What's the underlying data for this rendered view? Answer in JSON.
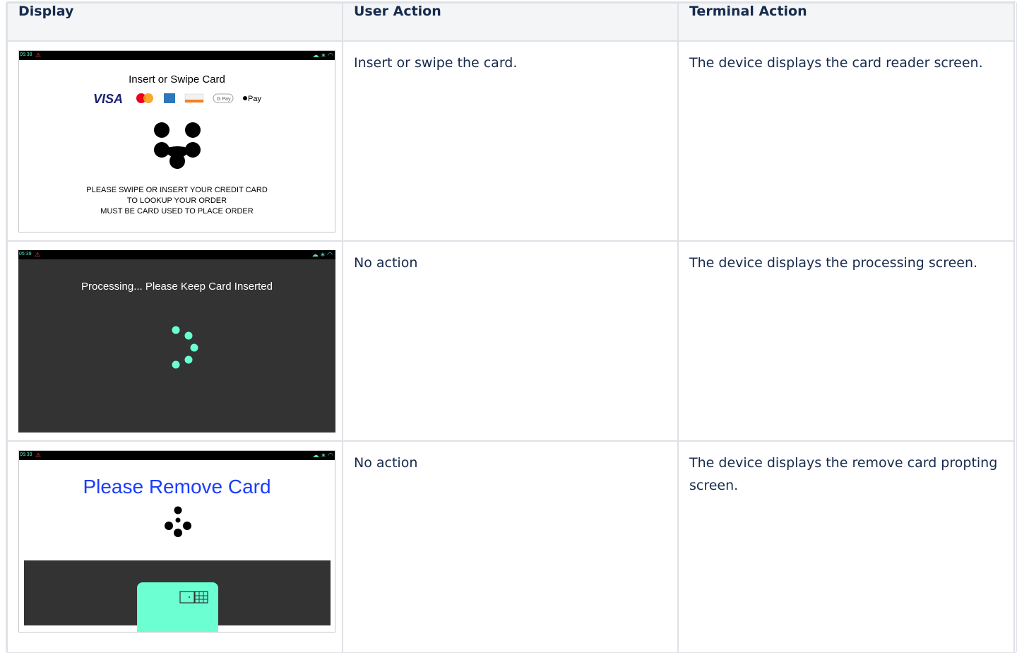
{
  "table": {
    "headers": [
      "Display",
      "User Action",
      "Terminal Action"
    ],
    "rows": [
      {
        "user_action": "Insert or swipe the card.",
        "terminal_action": "The device displays the card reader screen.",
        "screen": {
          "time": "05:38",
          "title": "Insert or Swipe Card",
          "logos": {
            "visa": "VISA",
            "gpay": "G Pay",
            "applepay": "Pay"
          },
          "message_lines": [
            "PLEASE SWIPE OR INSERT YOUR CREDIT CARD",
            "TO LOOKUP YOUR ORDER",
            "MUST BE CARD USED TO PLACE ORDER"
          ]
        }
      },
      {
        "user_action": "No action",
        "terminal_action": "The device displays the processing screen.",
        "screen": {
          "time": "05:39",
          "title": "Processing... Please Keep Card Inserted"
        }
      },
      {
        "user_action": "No action",
        "terminal_action": "The device displays the remove card propting screen.",
        "screen": {
          "time": "05:39",
          "title": "Please Remove Card"
        }
      }
    ]
  },
  "colors": {
    "header_bg": "#f4f5f7",
    "border": "#dfe1e6",
    "mint": "#6bffd2",
    "dark_screen": "#333333",
    "remove_title": "#1a3cff"
  },
  "icons": [
    "warning-icon",
    "cloud-icon",
    "bluetooth-icon",
    "wifi-icon",
    "visa-logo",
    "mastercard-logo",
    "amex-logo",
    "discover-logo",
    "gpay-logo",
    "applepay-logo",
    "card-reader-logo",
    "spinner-icon",
    "chip-card-icon"
  ]
}
